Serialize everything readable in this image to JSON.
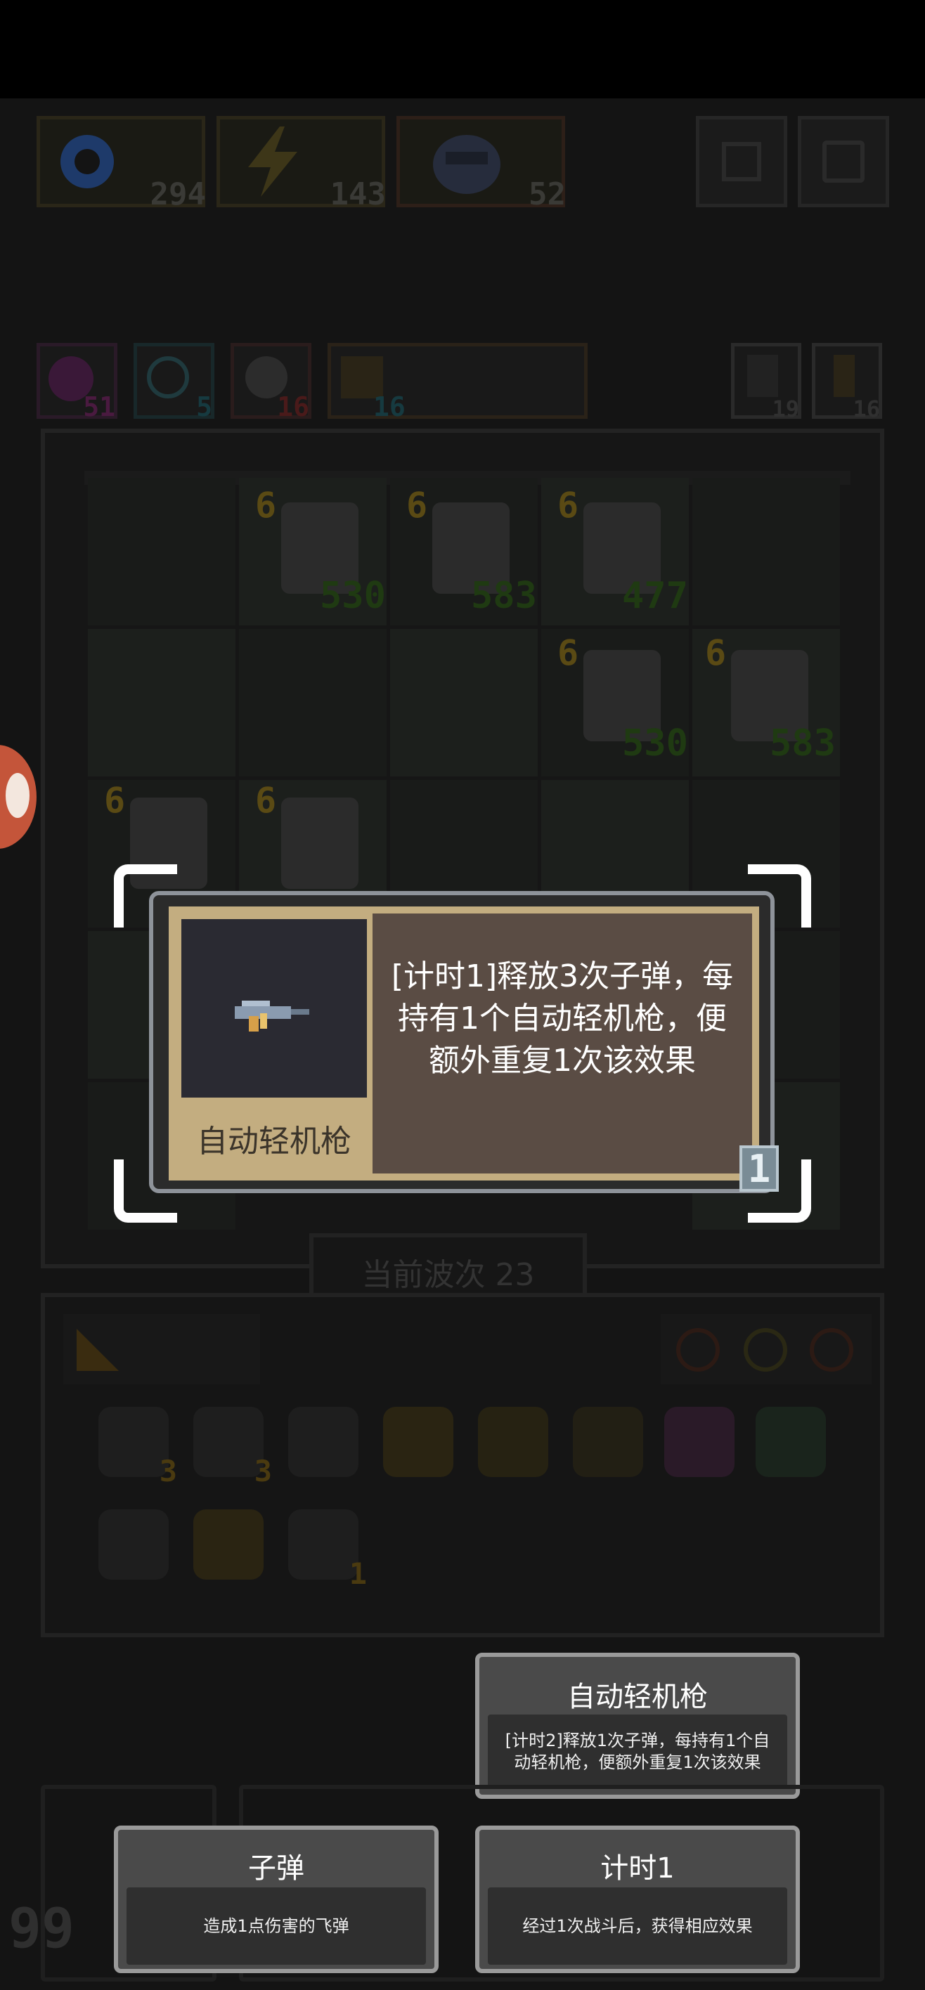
{
  "resources": [
    {
      "icon": "coin-icon",
      "value": "294",
      "color": "#2f6fd8"
    },
    {
      "icon": "lightning-icon",
      "value": "143",
      "color": "#e0c024"
    },
    {
      "icon": "monster-icon",
      "value": "52",
      "color": "#8aa0c8"
    }
  ],
  "stats": [
    {
      "icon": "magic-icon",
      "value": "51",
      "color": "#a03090"
    },
    {
      "icon": "clock-icon",
      "value": "5",
      "color": "#2a7a8a"
    },
    {
      "icon": "explosion-icon",
      "value": "16",
      "color": "#a03030"
    },
    {
      "icon": "bolt-icon",
      "value": "16",
      "color": "#2a7a8a"
    }
  ],
  "side_stats": [
    {
      "icon": "up-arrow-icon",
      "value": "19"
    },
    {
      "icon": "key-icon",
      "value": "16"
    }
  ],
  "heroes": [
    {
      "level": "6",
      "power": "530"
    },
    {
      "level": "6",
      "power": "583"
    },
    {
      "level": "6",
      "power": "477"
    },
    {
      "level": "6",
      "power": "530"
    },
    {
      "level": "6",
      "power": "583"
    },
    {
      "level": "6",
      "power": ""
    },
    {
      "level": "6",
      "power": ""
    }
  ],
  "wave": {
    "label": "当前波次 23"
  },
  "inventory": {
    "items": [
      {
        "icon": "heart-shield-icon",
        "count": "3"
      },
      {
        "icon": "ghost-icon",
        "count": "3"
      },
      {
        "icon": "shield-icon",
        "count": ""
      },
      {
        "icon": "horn-icon",
        "count": ""
      },
      {
        "icon": "potion-icon",
        "count": ""
      },
      {
        "icon": "star-wand-icon",
        "count": ""
      },
      {
        "icon": "gear-icon",
        "count": ""
      },
      {
        "icon": "lock-icon",
        "count": ""
      },
      {
        "icon": "magnet-icon",
        "count": ""
      },
      {
        "icon": "wings-icon",
        "count": ""
      },
      {
        "icon": "gun-icon",
        "count": "1"
      }
    ]
  },
  "popup": {
    "item_name": "自动轻机枪",
    "description": "[计时1]释放3次子弹，每持有1个自动轻机枪，便额外重复1次该效果",
    "count": "1"
  },
  "cards": {
    "top": {
      "title": "自动轻机枪",
      "desc": "[计时2]释放1次子弹，每持有1个自动轻机枪，便额外重复1次该效果"
    },
    "bullet": {
      "title": "子弹",
      "desc": "造成1点伤害的飞弹"
    },
    "timer": {
      "title": "计时1",
      "desc": "经过1次战斗后，获得相应效果"
    }
  },
  "corner_number": "99"
}
